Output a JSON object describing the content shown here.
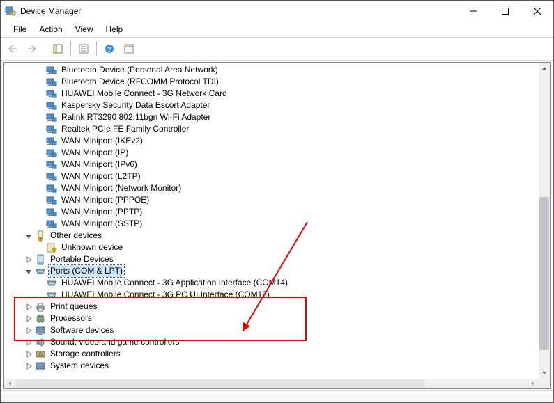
{
  "window": {
    "title": "Device Manager"
  },
  "menu": {
    "file": "File",
    "action": "Action",
    "view": "View",
    "help": "Help"
  },
  "tree": {
    "net": [
      "Bluetooth Device (Personal Area Network)",
      "Bluetooth Device (RFCOMM Protocol TDI)",
      "HUAWEI Mobile Connect - 3G Network Card",
      "Kaspersky Security Data Escort Adapter",
      "Ralink RT3290 802.11bgn Wi-Fi Adapter",
      "Realtek PCIe FE Family Controller",
      "WAN Miniport (IKEv2)",
      "WAN Miniport (IP)",
      "WAN Miniport (IPv6)",
      "WAN Miniport (L2TP)",
      "WAN Miniport (Network Monitor)",
      "WAN Miniport (PPPOE)",
      "WAN Miniport (PPTP)",
      "WAN Miniport (SSTP)"
    ],
    "other_devices": {
      "label": "Other devices",
      "items": [
        "Unknown device"
      ]
    },
    "portable_devices": "Portable Devices",
    "ports": {
      "label": "Ports (COM & LPT)",
      "items": [
        "HUAWEI Mobile Connect - 3G Application Interface (COM14)",
        "HUAWEI Mobile Connect - 3G PC UI Interface (COM12)"
      ]
    },
    "print_queues": "Print queues",
    "processors": "Processors",
    "software_devices": "Software devices",
    "sound": "Sound, video and game controllers",
    "storage": "Storage controllers",
    "system": "System devices"
  }
}
